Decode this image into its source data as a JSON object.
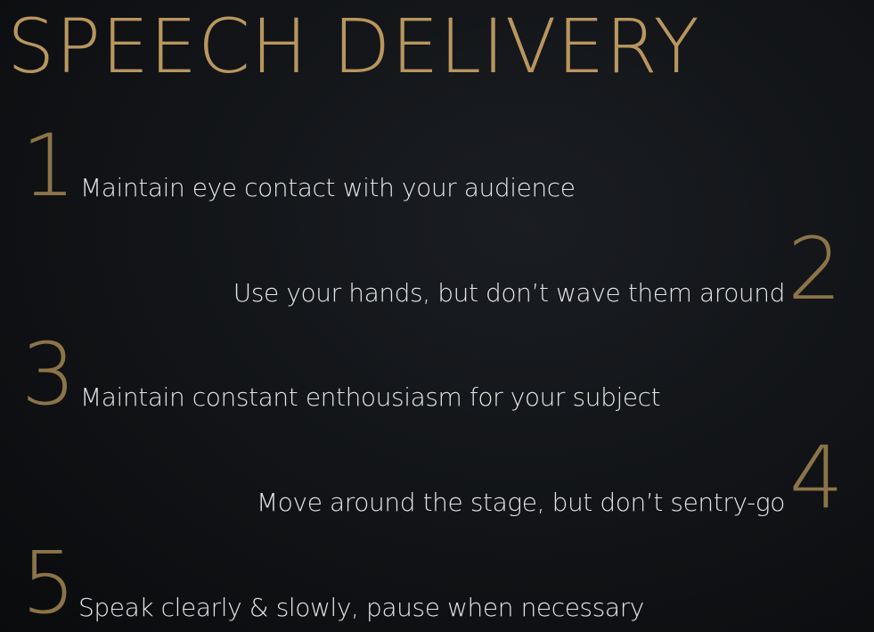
{
  "slide": {
    "title": "SPEECH DELIVERY",
    "points": [
      {
        "number": "1",
        "text": "Maintain eye contact with your audience"
      },
      {
        "number": "2",
        "text": "Use your hands, but don’t wave them around"
      },
      {
        "number": "3",
        "text": "Maintain constant enthousiasm for your subject"
      },
      {
        "number": "4",
        "text": "Move around the stage, but don’t sentry-go"
      },
      {
        "number": "5",
        "text": "Speak clearly & slowly, pause when necessary"
      }
    ]
  },
  "colors": {
    "title": "#b9965e",
    "numbers": "#8c7448",
    "text": "#e6e6e6",
    "background": "#111316"
  }
}
